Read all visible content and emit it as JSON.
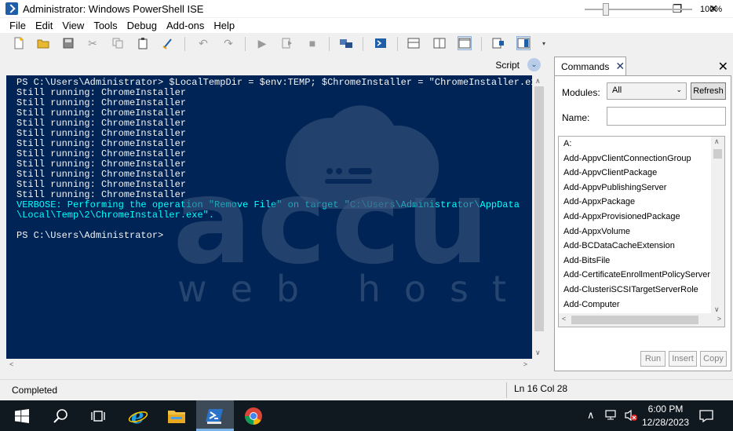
{
  "window": {
    "title": "Administrator: Windows PowerShell ISE",
    "minimize": "—",
    "maximize": "❐",
    "close": "✕"
  },
  "menu": [
    "File",
    "Edit",
    "View",
    "Tools",
    "Debug",
    "Add-ons",
    "Help"
  ],
  "toolbar_icons": [
    "new-icon",
    "open-icon",
    "save-icon",
    "cut-icon",
    "copy-icon",
    "paste-icon",
    "clear-console-icon",
    "undo-icon",
    "redo-icon",
    "run-icon",
    "run-selection-icon",
    "stop-icon",
    "remote-powershell-icon",
    "powershell-console-icon",
    "show-script-top-icon",
    "show-script-right-icon",
    "show-script-max-icon",
    "show-command-window-icon",
    "show-command-addon-icon"
  ],
  "script_pane": {
    "label": "Script",
    "toggle_icon": "chevron-down-icon"
  },
  "console": {
    "lines": [
      {
        "text": "PS C:\\Users\\Administrator> $LocalTempDir = $env:TEMP; $ChromeInstaller = \"ChromeInstaller.exe\"; (n",
        "type": "normal"
      },
      {
        "text": "Still running: ChromeInstaller",
        "type": "normal"
      },
      {
        "text": "Still running: ChromeInstaller",
        "type": "normal"
      },
      {
        "text": "Still running: ChromeInstaller",
        "type": "normal"
      },
      {
        "text": "Still running: ChromeInstaller",
        "type": "normal"
      },
      {
        "text": "Still running: ChromeInstaller",
        "type": "normal"
      },
      {
        "text": "Still running: ChromeInstaller",
        "type": "normal"
      },
      {
        "text": "Still running: ChromeInstaller",
        "type": "normal"
      },
      {
        "text": "Still running: ChromeInstaller",
        "type": "normal"
      },
      {
        "text": "Still running: ChromeInstaller",
        "type": "normal"
      },
      {
        "text": "Still running: ChromeInstaller",
        "type": "normal"
      },
      {
        "text": "Still running: ChromeInstaller",
        "type": "normal"
      },
      {
        "text": "VERBOSE: Performing the operation \"Remove File\" on target \"C:\\Users\\Administrator\\AppData",
        "type": "verbose"
      },
      {
        "text": "\\Local\\Temp\\2\\ChromeInstaller.exe\".",
        "type": "verbose"
      },
      {
        "text": "",
        "type": "normal"
      },
      {
        "text": "PS C:\\Users\\Administrator>",
        "type": "normal"
      }
    ]
  },
  "watermark": {
    "brand": "accu",
    "tagline": "web hostin"
  },
  "commands": {
    "tab_label": "Commands",
    "tab_close": "✕",
    "pane_close": "✕",
    "modules_label": "Modules:",
    "modules_value": "All",
    "refresh_label": "Refresh",
    "name_label": "Name:",
    "name_value": "",
    "items": [
      "A:",
      "Add-AppvClientConnectionGroup",
      "Add-AppvClientPackage",
      "Add-AppvPublishingServer",
      "Add-AppxPackage",
      "Add-AppxProvisionedPackage",
      "Add-AppxVolume",
      "Add-BCDataCacheExtension",
      "Add-BitsFile",
      "Add-CertificateEnrollmentPolicyServer",
      "Add-ClusteriSCSITargetServerRole",
      "Add-Computer"
    ],
    "run_label": "Run",
    "insert_label": "Insert",
    "copy_label": "Copy"
  },
  "status": {
    "text": "Completed",
    "line_col": "Ln 16  Col 28",
    "zoom": "100%",
    "zoom_fraction": 0.2
  },
  "taskbar": {
    "icons": [
      "windows-start-icon",
      "search-icon",
      "task-view-icon",
      "internet-explorer-icon",
      "file-explorer-icon",
      "powershell-ise-icon",
      "chrome-icon"
    ],
    "tray_icons": [
      "chevron-up-icon",
      "network-icon",
      "volume-muted-icon",
      "notification-icon"
    ],
    "time": "6:00 PM",
    "date": "12/28/2023",
    "active_color": "#7bb3e8"
  },
  "colors": {
    "console_bg": "#012456",
    "console_text": "#f5f5f5",
    "verbose": "#00ffff"
  }
}
